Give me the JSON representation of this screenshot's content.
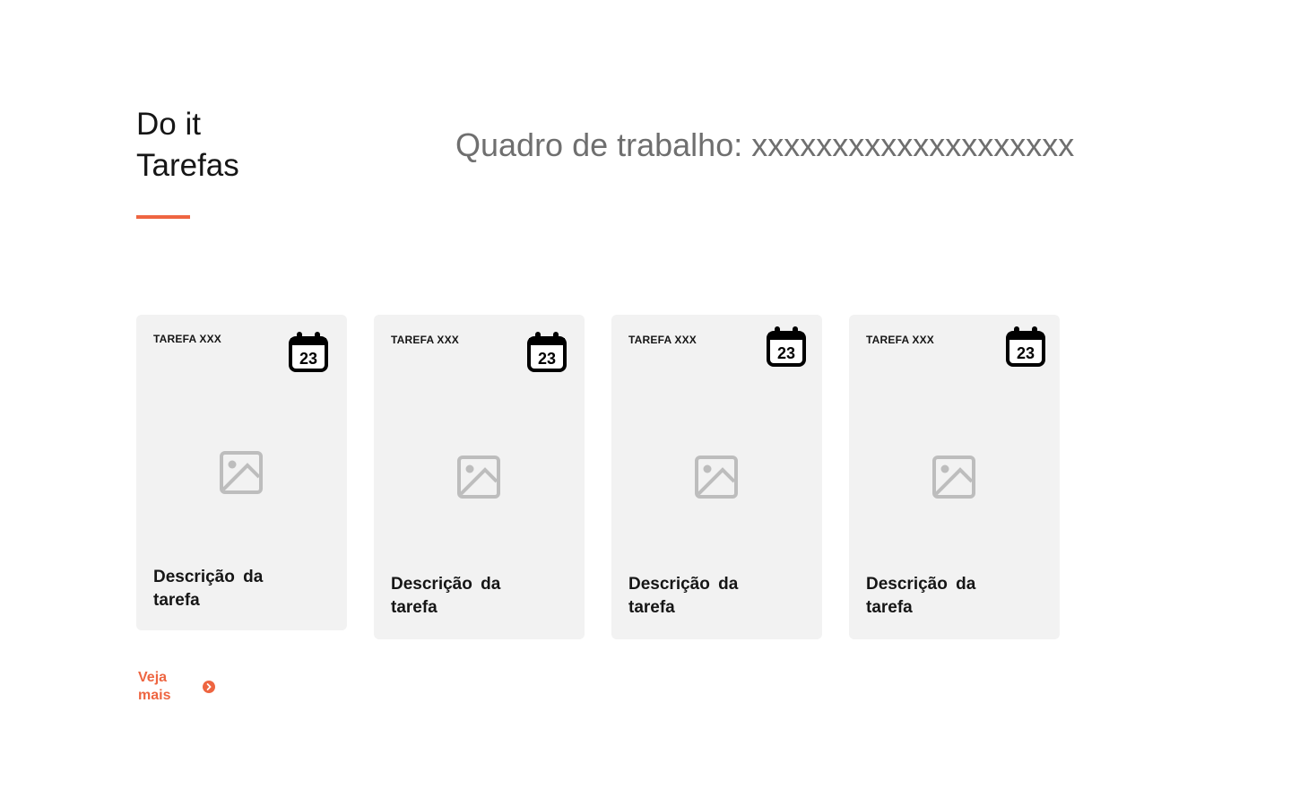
{
  "header": {
    "brand_line1": "Do it",
    "brand_line2": "Tarefas",
    "board_title": "Quadro de trabalho: xxxxxxxxxxxxxxxxxxxx"
  },
  "cards": [
    {
      "label": "TAREFA XXX",
      "calendar_day": "23",
      "description": "Descrição da tarefa",
      "image_icon": "image-placeholder-icon"
    },
    {
      "label": "TAREFA XXX",
      "calendar_day": "23",
      "description": "Descrição da tarefa",
      "image_icon": "image-placeholder-icon"
    },
    {
      "label": "TAREFA XXX",
      "calendar_day": "23",
      "description": "Descrição da tarefa",
      "image_icon": "image-placeholder-icon"
    },
    {
      "label": "TAREFA XXX",
      "calendar_day": "23",
      "description": "Descrição da tarefa",
      "image_icon": "image-placeholder-icon"
    }
  ],
  "footer": {
    "see_more_label": "Veja mais",
    "see_more_icon": "chevron-right-circle-icon"
  },
  "colors": {
    "accent": "#ee6541",
    "card_background": "#f2f2f2",
    "title_gray": "#6f6f6f",
    "text": "#161616",
    "placeholder_gray": "#bdbdbd"
  }
}
